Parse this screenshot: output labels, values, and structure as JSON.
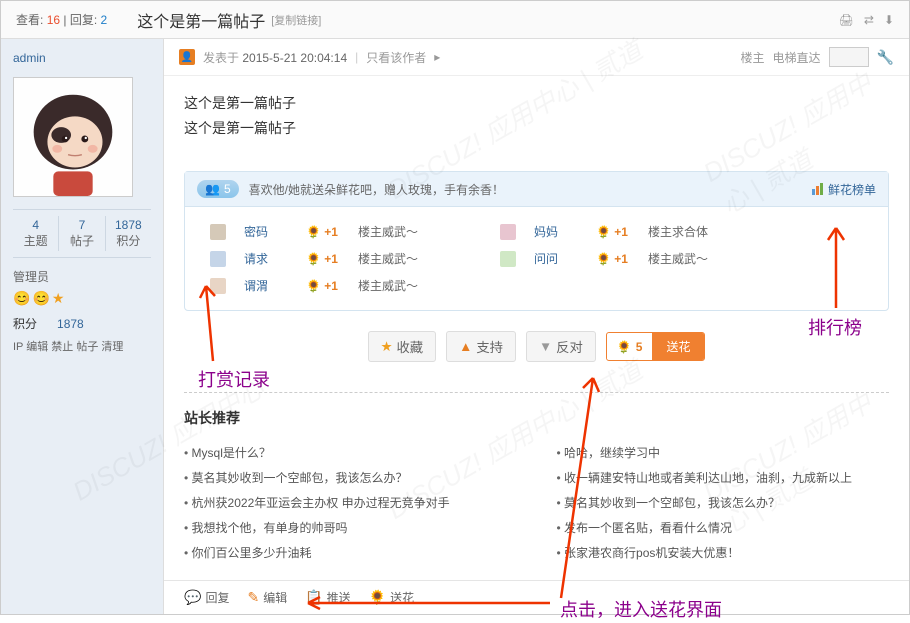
{
  "header": {
    "view_label": "查看:",
    "view_count": "16",
    "reply_label": "回复:",
    "reply_count": "2",
    "title": "这个是第一篇帖子",
    "copy_link": "[复制链接]"
  },
  "sidebar": {
    "username": "admin",
    "stats": [
      {
        "num": "4",
        "label": "主题"
      },
      {
        "num": "7",
        "label": "帖子"
      },
      {
        "num": "1878",
        "label": "积分"
      }
    ],
    "role": "管理员",
    "points_label": "积分",
    "points_value": "1878",
    "ip_edit": "IP 编辑 禁止 帖子 清理"
  },
  "postmeta": {
    "post_label": "发表于",
    "post_time": "2015-5-21 20:04:14",
    "author_only": "只看该作者",
    "floor": "楼主",
    "elevator": "电梯直达"
  },
  "postbody": {
    "line1": "这个是第一篇帖子",
    "line2": "这个是第一篇帖子"
  },
  "flowerbox": {
    "badge_num": "5",
    "header_text": "喜欢他/她就送朵鲜花吧，赠人玫瑰，手有余香！",
    "rank_link": "鲜花榜单",
    "rows": [
      {
        "name": "密码",
        "plus": "+1",
        "comment": "楼主威武～",
        "name2": "妈妈",
        "plus2": "+1",
        "comment2": "楼主求合体"
      },
      {
        "name": "请求",
        "plus": "+1",
        "comment": "楼主威武～",
        "name2": "问问",
        "plus2": "+1",
        "comment2": "楼主威武～"
      },
      {
        "name": "谓渭",
        "plus": "+1",
        "comment": "楼主威武～",
        "name2": "",
        "plus2": "",
        "comment2": ""
      }
    ]
  },
  "actions": {
    "favorite": "收藏",
    "support": "支持",
    "oppose": "反对",
    "send_num": "5",
    "send_label": "送花"
  },
  "recommend": {
    "title": "站长推荐",
    "col1": [
      "Mysql是什么？",
      "莫名其妙收到一个空邮包，我该怎么办？",
      "杭州获2022年亚运会主办权 申办过程无竞争对手",
      "我想找个他，有单身的帅哥吗",
      "你们百公里多少升油耗"
    ],
    "col2": [
      "哈哈，继续学习中",
      "收一辆建安特山地或者美利达山地，油刹，九成新以上",
      "莫名其妙收到一个空邮包，我该怎么办？",
      "发布一个匿名贴，看看什么情况",
      "张家港农商行pos机安装大优惠！"
    ]
  },
  "footer": {
    "reply": "回复",
    "edit": "编辑",
    "push": "推送",
    "flower": "送花"
  },
  "annotations": {
    "reward": "打赏记录",
    "rank": "排行榜",
    "click": "点击，进入送花界面"
  }
}
